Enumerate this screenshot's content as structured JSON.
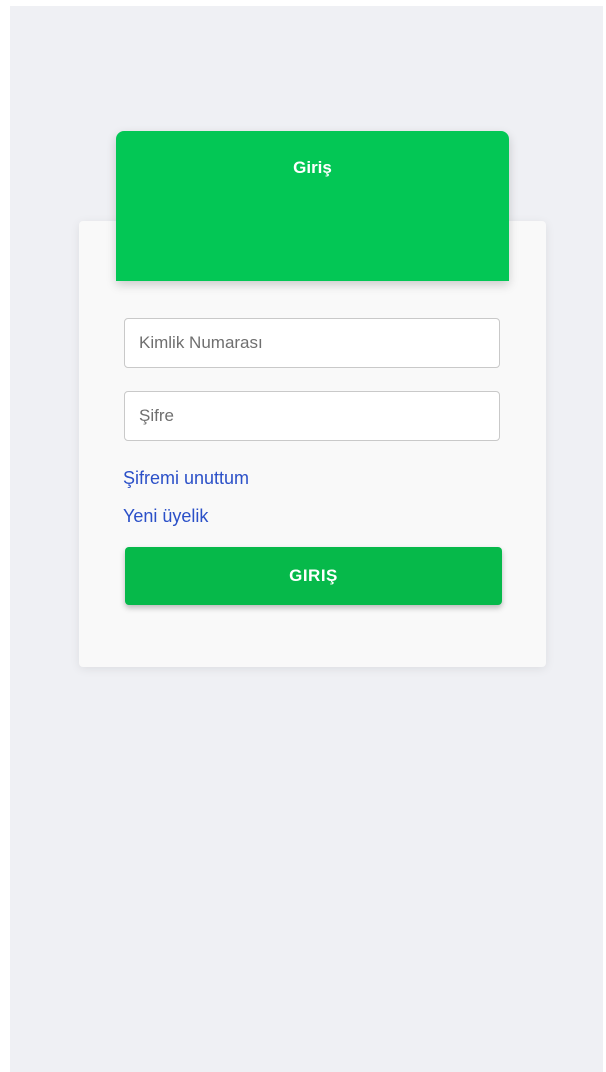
{
  "colors": {
    "background": "#eff0f4",
    "card": "#f9f9f9",
    "header": "#03c755",
    "button": "#06b94a",
    "link": "#2b50c8"
  },
  "header": {
    "title": "Giriş"
  },
  "form": {
    "id_placeholder": "Kimlik Numarası",
    "password_placeholder": "Şifre",
    "forgot_link": "Şifremi unuttum",
    "register_link": "Yeni üyelik",
    "submit_label": "GIRIŞ"
  }
}
